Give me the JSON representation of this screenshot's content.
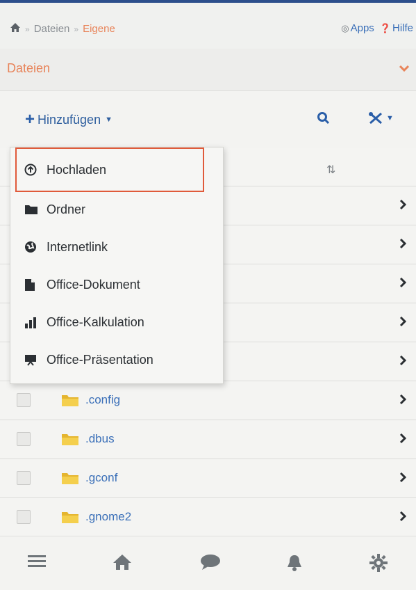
{
  "breadcrumb": {
    "items": [
      "Dateien",
      "Eigene"
    ]
  },
  "toplinks": {
    "apps": "Apps",
    "help": "Hilfe"
  },
  "section": {
    "title": "Dateien"
  },
  "toolbar": {
    "add_label": "Hinzufügen"
  },
  "dropdown": {
    "items": [
      {
        "label": "Hochladen",
        "icon": "upload-icon"
      },
      {
        "label": "Ordner",
        "icon": "folder-icon"
      },
      {
        "label": "Internetlink",
        "icon": "globe-icon"
      },
      {
        "label": "Office-Dokument",
        "icon": "document-icon"
      },
      {
        "label": "Office-Kalkulation",
        "icon": "bar-chart-icon"
      },
      {
        "label": "Office-Präsentation",
        "icon": "presentation-icon"
      }
    ]
  },
  "files": [
    ".config",
    ".dbus",
    ".gconf",
    ".gnome2"
  ],
  "colors": {
    "accent": "#e8845a",
    "link": "#3a6fb8",
    "highlight": "#e05a3a"
  },
  "bottom_nav": [
    "menu-icon",
    "home-icon",
    "chat-icon",
    "bell-icon",
    "gear-icon"
  ]
}
